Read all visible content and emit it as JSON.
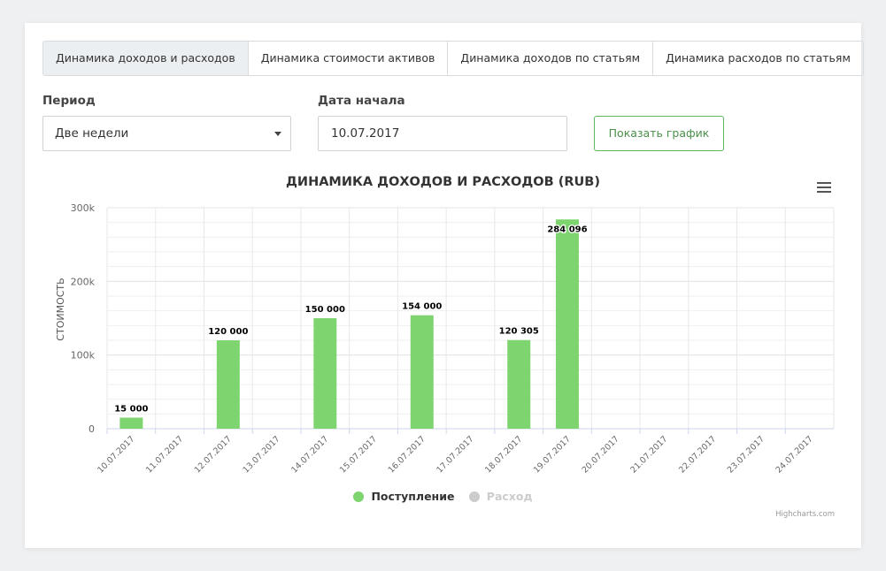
{
  "tabs": [
    {
      "label": "Динамика доходов и расходов",
      "active": true
    },
    {
      "label": "Динамика стоимости активов",
      "active": false
    },
    {
      "label": "Динамика доходов по статьям",
      "active": false
    },
    {
      "label": "Динамика расходов по статьям",
      "active": false
    }
  ],
  "form": {
    "period_label": "Период",
    "period_value": "Две недели",
    "start_label": "Дата начала",
    "start_value": "10.07.2017",
    "show_button": "Показать график"
  },
  "colors": {
    "income": "#7ed56f",
    "expense": "#cccccc",
    "accent": "#5cb85c"
  },
  "chart_data": {
    "type": "bar",
    "title": "ДИНАМИКА ДОХОДОВ И РАСХОДОВ (RUB)",
    "ylabel": "СТОИМОСТЬ",
    "xlabel": "",
    "ylim": [
      0,
      300000
    ],
    "yticks": [
      {
        "value": 0,
        "label": "0"
      },
      {
        "value": 100000,
        "label": "100k"
      },
      {
        "value": 200000,
        "label": "200k"
      },
      {
        "value": 300000,
        "label": "300k"
      }
    ],
    "categories": [
      "10.07.2017",
      "11.07.2017",
      "12.07.2017",
      "13.07.2017",
      "14.07.2017",
      "15.07.2017",
      "16.07.2017",
      "17.07.2017",
      "18.07.2017",
      "19.07.2017",
      "20.07.2017",
      "21.07.2017",
      "22.07.2017",
      "23.07.2017",
      "24.07.2017"
    ],
    "series": [
      {
        "name": "Поступление",
        "values": [
          15000,
          null,
          120000,
          null,
          150000,
          null,
          154000,
          null,
          120305,
          284096,
          null,
          null,
          null,
          null,
          null
        ],
        "labels": [
          "15 000",
          "",
          "120 000",
          "",
          "150 000",
          "",
          "154 000",
          "",
          "120 305",
          "284 096",
          "",
          "",
          "",
          "",
          ""
        ]
      },
      {
        "name": "Расход",
        "values": [
          null,
          null,
          null,
          null,
          null,
          null,
          null,
          null,
          null,
          null,
          null,
          null,
          null,
          null,
          null
        ]
      }
    ],
    "grid": true,
    "legend": "bottom-center",
    "credits": "Highcharts.com"
  }
}
